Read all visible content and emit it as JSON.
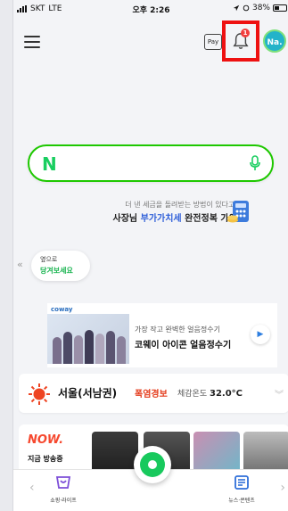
{
  "status_bar": {
    "carrier": "SKT",
    "network": "LTE",
    "time": "오후 2:26",
    "battery": "38%"
  },
  "header": {
    "menu_icon": "hamburger-menu-icon",
    "pay_label": "Pay",
    "notification_count": "1",
    "avatar_label": "Na."
  },
  "search": {
    "logo": "N",
    "value": "",
    "placeholder": ""
  },
  "tax_promo": {
    "subtitle": "더 낸 세금을 돌려받는 방법이 있다고요?",
    "title_prefix": "사장님 ",
    "title_highlight": "부가가치세",
    "title_suffix": " 완전정복 가이드"
  },
  "swipe_hint": {
    "arrow": "«",
    "line1": "옆으로",
    "line2": "당겨보세요"
  },
  "ad": {
    "brand": "coway",
    "small_text": "가장 작고 완벽한 얼음정수기",
    "title": "코웨이 아이콘 얼음정수기",
    "play_symbol": "▶"
  },
  "weather": {
    "city": "서울(서남권)",
    "alert": "폭염경보",
    "feel_label": "체감온도",
    "feel_value": "32.0°C",
    "more_symbol": "︾"
  },
  "now_section": {
    "logo": "NOW.",
    "subtitle": "지금 방송중"
  },
  "bottom_nav": {
    "left_arrow": "‹",
    "right_arrow": "›",
    "shop_label": "쇼핑·라이프",
    "news_label": "뉴스·콘텐츠"
  },
  "colors": {
    "naver_green": "#1ec800",
    "highlight_red": "#ee1111",
    "alert_red": "#e43c1c",
    "link_blue": "#2f5fd9"
  }
}
